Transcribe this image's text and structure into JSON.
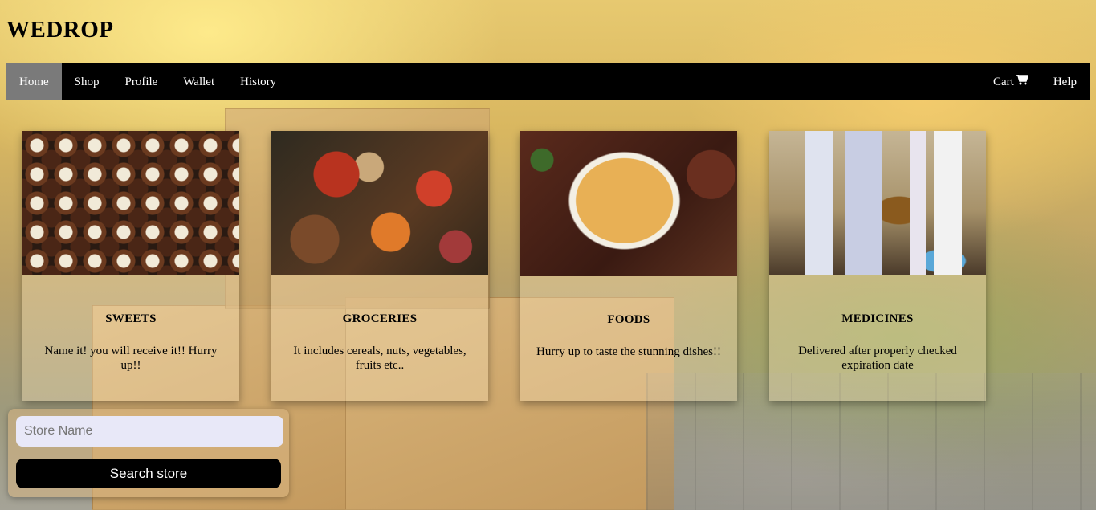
{
  "brand": {
    "name": "WEDROP"
  },
  "nav": {
    "items": [
      {
        "label": "Home",
        "active": true
      },
      {
        "label": "Shop"
      },
      {
        "label": "Profile"
      },
      {
        "label": "Wallet"
      },
      {
        "label": "History"
      }
    ],
    "cart_label": "Cart",
    "cart_icon": "shopping-cart-icon",
    "help_label": "Help",
    "active_color": "#7a7a7a",
    "bar_color": "#000000"
  },
  "categories": [
    {
      "title": "SWEETS",
      "description": "Name it! you will receive it!! Hurry up!!",
      "image": "chocolates-image"
    },
    {
      "title": "GROCERIES",
      "description": "It includes cereals, nuts, vegetables, fruits etc..",
      "image": "groceries-image"
    },
    {
      "title": "FOODS",
      "description": "Hurry up to taste the stunning dishes!!",
      "image": "biryani-image"
    },
    {
      "title": "MEDICINES",
      "description": "Delivered after properly checked expiration date",
      "image": "medicines-image"
    }
  ],
  "search": {
    "placeholder": "Store Name",
    "value": "",
    "button_label": "Search store"
  }
}
